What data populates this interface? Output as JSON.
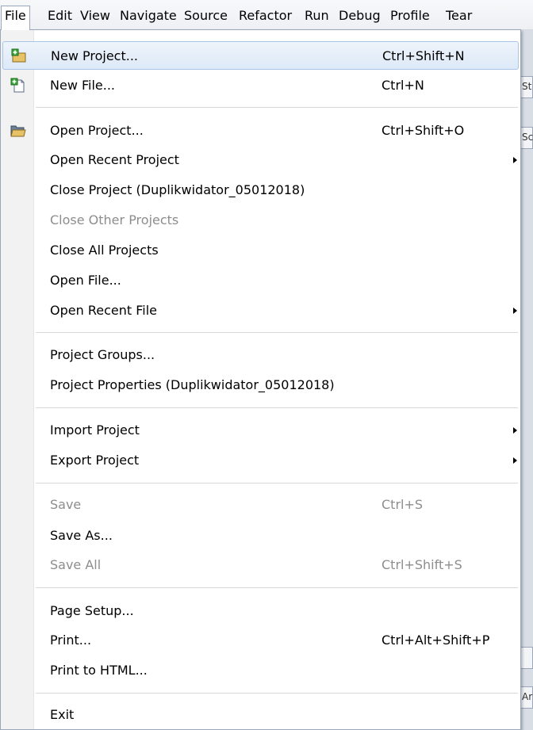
{
  "menubar": {
    "items": [
      "File",
      "Edit",
      "View",
      "Navigate",
      "Source",
      "Refactor",
      "Run",
      "Debug",
      "Profile",
      "Tear"
    ]
  },
  "background": {
    "frag1": "St",
    "frag2": "Sc",
    "frag3": "Ar"
  },
  "menu": {
    "new_project": {
      "label": "New Project...",
      "shortcut": "Ctrl+Shift+N",
      "icon": "new-project-icon"
    },
    "new_file": {
      "label": "New File...",
      "shortcut": "Ctrl+N",
      "icon": "new-file-icon"
    },
    "open_project": {
      "label": "Open Project...",
      "shortcut": "Ctrl+Shift+O",
      "icon": "open-project-icon"
    },
    "open_recent_project": {
      "label": "Open Recent Project"
    },
    "close_project": {
      "label": "Close Project (Duplikwidator_05012018)"
    },
    "close_other_projects": {
      "label": "Close Other Projects"
    },
    "close_all_projects": {
      "label": "Close All Projects"
    },
    "open_file": {
      "label": "Open File..."
    },
    "open_recent_file": {
      "label": "Open Recent File"
    },
    "project_groups": {
      "label": "Project Groups..."
    },
    "project_properties": {
      "label": "Project Properties (Duplikwidator_05012018)"
    },
    "import_project": {
      "label": "Import Project"
    },
    "export_project": {
      "label": "Export Project"
    },
    "save": {
      "label": "Save",
      "shortcut": "Ctrl+S"
    },
    "save_as": {
      "label": "Save As..."
    },
    "save_all": {
      "label": "Save All",
      "shortcut": "Ctrl+Shift+S"
    },
    "page_setup": {
      "label": "Page Setup..."
    },
    "print": {
      "label": "Print...",
      "shortcut": "Ctrl+Alt+Shift+P"
    },
    "print_to_html": {
      "label": "Print to HTML..."
    },
    "exit": {
      "label": "Exit"
    }
  },
  "colors": {
    "highlight": "#dde9f7",
    "disabled_text": "#8d8d8d",
    "border": "#9aa7bb"
  }
}
